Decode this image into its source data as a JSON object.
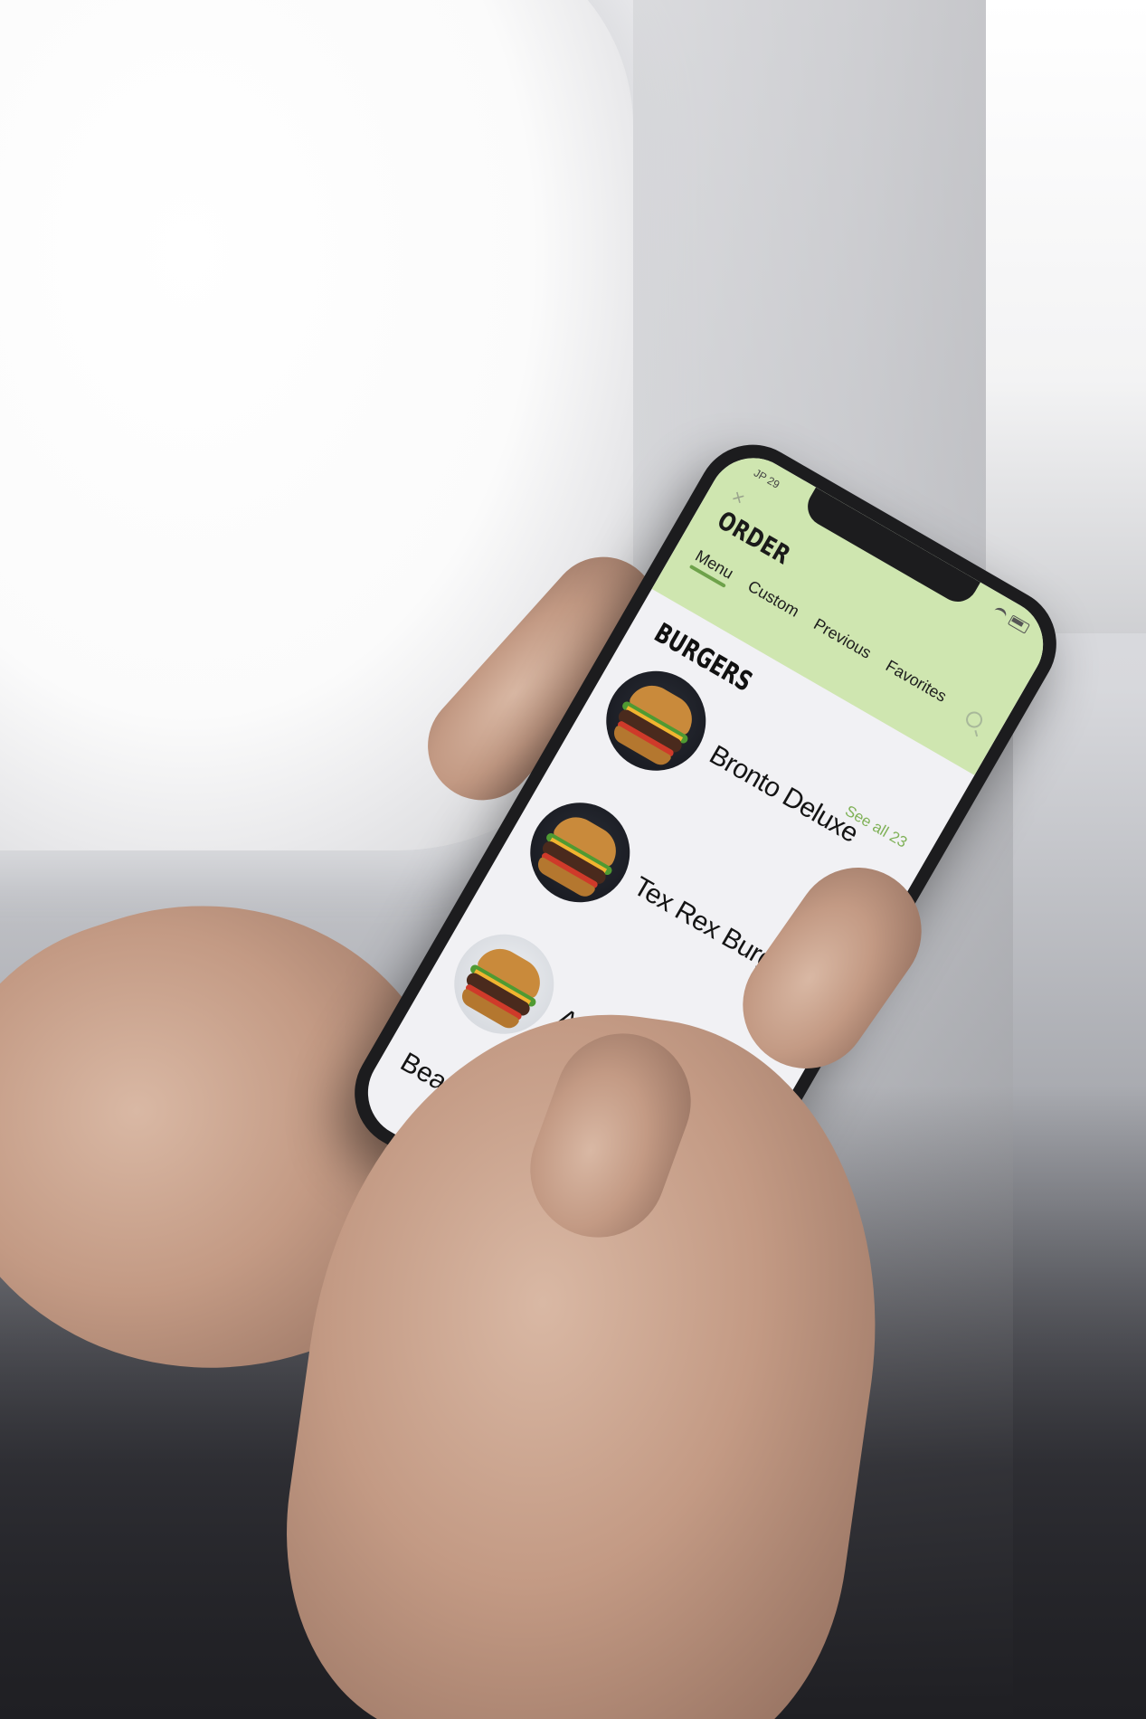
{
  "status_bar": {
    "time": "JP 29"
  },
  "header": {
    "close_glyph": "×",
    "title": "ORDER",
    "tabs": [
      {
        "label": "Menu",
        "active": true
      },
      {
        "label": "Custom",
        "active": false
      },
      {
        "label": "Previous",
        "active": false
      },
      {
        "label": "Favorites",
        "active": false
      }
    ]
  },
  "section": {
    "title": "BURGERS",
    "see_all": "See all 23"
  },
  "items": [
    {
      "name": "Bronto Deluxe"
    },
    {
      "name": "Tex Rex Burger"
    },
    {
      "name": "Asian Apato"
    },
    {
      "name": "Bea"
    }
  ],
  "colors": {
    "header_bg": "#cfe6b0",
    "accent": "#6ea24a",
    "see_all": "#7fb157",
    "screen_bg": "#f1f1f4"
  },
  "icons": [
    "close-icon",
    "search-icon",
    "wifi-icon",
    "battery-icon"
  ]
}
